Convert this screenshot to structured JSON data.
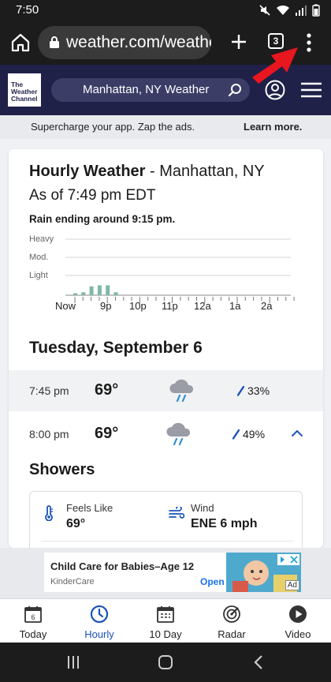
{
  "status_bar": {
    "time": "7:50"
  },
  "browser": {
    "url": "weather.com/weather/hourbyhour/l/Manhattan+NY",
    "tab_count": "3"
  },
  "header": {
    "logo_lines": [
      "The",
      "Weather",
      "Channel"
    ],
    "search_text": "Manhattan, NY Weather"
  },
  "promo": {
    "text": "Supercharge your app. Zap the ads.",
    "link": "Learn more."
  },
  "card": {
    "title_bold": "Hourly Weather",
    "title_rest": " - Manhattan, NY",
    "as_of": "As of 7:49 pm EDT",
    "rain_note": "Rain ending around 9:15 pm.",
    "chart": {
      "y_labels": [
        "Heavy",
        "Mod.",
        "Light"
      ],
      "x_labels": [
        "Now",
        "9p",
        "10p",
        "11p",
        "12a",
        "1a",
        "2a"
      ]
    }
  },
  "chart_data": {
    "type": "bar",
    "categories": [
      "Now",
      "",
      "",
      "",
      "",
      "",
      "",
      "9p"
    ],
    "values": [
      0.1,
      0.15,
      0.45,
      0.5,
      0.5,
      0.15,
      0,
      0
    ],
    "y_categories": [
      "Light",
      "Mod.",
      "Heavy"
    ],
    "grid": true,
    "color": "#7fb7a8"
  },
  "day_heading": "Tuesday, September 6",
  "hours": [
    {
      "time": "7:45 pm",
      "temp": "69°",
      "precip": "33%"
    },
    {
      "time": "8:00 pm",
      "temp": "69°",
      "precip": "49%"
    }
  ],
  "details": {
    "condition": "Showers",
    "feels_like_label": "Feels Like",
    "feels_like_value": "69°",
    "wind_label": "Wind",
    "wind_value": "ENE 6 mph"
  },
  "ad": {
    "title": "Child Care for Babies–Age 12",
    "advertiser": "KinderCare",
    "cta": "Open",
    "badge": "Ad"
  },
  "nav": {
    "items": [
      {
        "label": "Today",
        "day_number": "6"
      },
      {
        "label": "Hourly"
      },
      {
        "label": "10 Day"
      },
      {
        "label": "Radar"
      },
      {
        "label": "Video"
      }
    ]
  },
  "colors": {
    "brand_navy": "#1f2148",
    "active_blue": "#1a53b8",
    "precip_bar": "#7fb7a8",
    "annotation_red": "#e8161e"
  }
}
